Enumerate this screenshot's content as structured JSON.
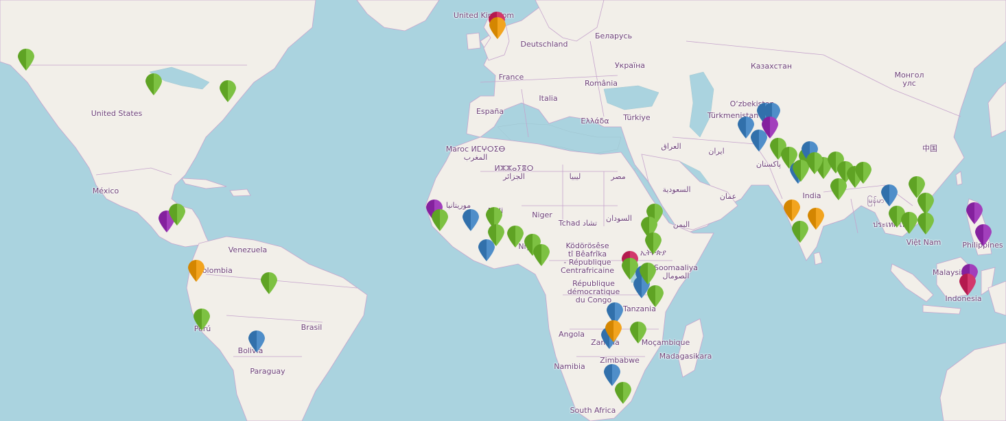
{
  "labels": [
    {
      "key": "uk",
      "text": "United Kingdom"
    },
    {
      "key": "de",
      "text": "Deutschland"
    },
    {
      "key": "by",
      "text": "Беларусь"
    },
    {
      "key": "ua",
      "text": "Україна"
    },
    {
      "key": "kz",
      "text": "Казахстан"
    },
    {
      "key": "mn",
      "text": "Монгол\nулс"
    },
    {
      "key": "fr",
      "text": "France"
    },
    {
      "key": "ro",
      "text": "România"
    },
    {
      "key": "es",
      "text": "España"
    },
    {
      "key": "it",
      "text": "Italia"
    },
    {
      "key": "gr",
      "text": "Ελλάδα"
    },
    {
      "key": "tr",
      "text": "Türkiye"
    },
    {
      "key": "uz",
      "text": "O‘zbekiston"
    },
    {
      "key": "tm",
      "text": "Türkmenistan"
    },
    {
      "key": "us",
      "text": "United States"
    },
    {
      "key": "ma",
      "text": "Maroc ⵍⵎⵖⵔⵉⴱ\nالمغرب"
    },
    {
      "key": "dz",
      "text": "ⵍⵣⵣⴰⵢⴻⵔ\nالجزائر"
    },
    {
      "key": "ly",
      "text": "ليبيا"
    },
    {
      "key": "eg",
      "text": "مصر"
    },
    {
      "key": "iq",
      "text": "العراق"
    },
    {
      "key": "ir",
      "text": "ایران"
    },
    {
      "key": "pk",
      "text": "پاکستان"
    },
    {
      "key": "cn",
      "text": "中国"
    },
    {
      "key": "mx",
      "text": "México"
    },
    {
      "key": "sa",
      "text": "السعودية"
    },
    {
      "key": "om",
      "text": "عمان"
    },
    {
      "key": "in",
      "text": "India"
    },
    {
      "key": "mr",
      "text": "موريتانيا"
    },
    {
      "key": "ml",
      "text": "Mali"
    },
    {
      "key": "ne",
      "text": "Niger"
    },
    {
      "key": "td",
      "text": "Tchad تشاد"
    },
    {
      "key": "sd",
      "text": "السودان"
    },
    {
      "key": "ye",
      "text": "اليمن"
    },
    {
      "key": "mm",
      "text": "မြန်မာ"
    },
    {
      "key": "th",
      "text": "ประเทศไทย"
    },
    {
      "key": "vn",
      "text": "Việt Nam"
    },
    {
      "key": "ph",
      "text": "Philippines"
    },
    {
      "key": "ve",
      "text": "Venezuela"
    },
    {
      "key": "ng",
      "text": "Nigeria"
    },
    {
      "key": "cf",
      "text": "Ködörösêse\ntî Bêafrîka\n- République\nCentrafricaine"
    },
    {
      "key": "et",
      "text": "ኢትዮጵያ"
    },
    {
      "key": "so",
      "text": "Soomaaliya\nالصومال"
    },
    {
      "key": "co",
      "text": "Colombia"
    },
    {
      "key": "my",
      "text": "Malaysia"
    },
    {
      "key": "cd",
      "text": "République\ndémocratique\ndu Congo"
    },
    {
      "key": "id",
      "text": "Indonesia"
    },
    {
      "key": "tz",
      "text": "Tanzania"
    },
    {
      "key": "br",
      "text": "Brasil"
    },
    {
      "key": "pe",
      "text": "Perú"
    },
    {
      "key": "ao",
      "text": "Angola"
    },
    {
      "key": "zm",
      "text": "Zambia"
    },
    {
      "key": "mz",
      "text": "Moçambique"
    },
    {
      "key": "bo",
      "text": "Bolivia"
    },
    {
      "key": "zw",
      "text": "Zimbabwe"
    },
    {
      "key": "mg",
      "text": "Madagasikara"
    },
    {
      "key": "na",
      "text": "Namibia"
    },
    {
      "key": "py",
      "text": "Paraguay"
    },
    {
      "key": "za",
      "text": "South Africa"
    }
  ],
  "marker_colors": {
    "green": "#7dc142",
    "blue": "#4f8ec9",
    "purple": "#a23fbc",
    "orange": "#f2a41f",
    "red": "#d2386c"
  },
  "markers": [
    {
      "color": "green"
    },
    {
      "color": "green"
    },
    {
      "color": "green"
    },
    {
      "color": "purple"
    },
    {
      "color": "green"
    },
    {
      "color": "orange"
    },
    {
      "color": "green"
    },
    {
      "color": "green"
    },
    {
      "color": "blue"
    },
    {
      "color": "red"
    },
    {
      "color": "orange"
    },
    {
      "color": "purple"
    },
    {
      "color": "green"
    },
    {
      "color": "blue"
    },
    {
      "color": "green"
    },
    {
      "color": "green"
    },
    {
      "color": "blue"
    },
    {
      "color": "green"
    },
    {
      "color": "green"
    },
    {
      "color": "green"
    },
    {
      "color": "green"
    },
    {
      "color": "green"
    },
    {
      "color": "green"
    },
    {
      "color": "red"
    },
    {
      "color": "green"
    },
    {
      "color": "blue"
    },
    {
      "color": "green"
    },
    {
      "color": "blue"
    },
    {
      "color": "green"
    },
    {
      "color": "blue"
    },
    {
      "color": "blue"
    },
    {
      "color": "orange"
    },
    {
      "color": "green"
    },
    {
      "color": "blue"
    },
    {
      "color": "green"
    },
    {
      "color": "blue"
    },
    {
      "color": "blue"
    },
    {
      "color": "blue"
    },
    {
      "color": "purple"
    },
    {
      "color": "blue"
    },
    {
      "color": "green"
    },
    {
      "color": "green"
    },
    {
      "color": "blue"
    },
    {
      "color": "green"
    },
    {
      "color": "green"
    },
    {
      "color": "green"
    },
    {
      "color": "blue"
    },
    {
      "color": "green"
    },
    {
      "color": "green"
    },
    {
      "color": "green"
    },
    {
      "color": "green"
    },
    {
      "color": "green"
    },
    {
      "color": "green"
    },
    {
      "color": "orange"
    },
    {
      "color": "orange"
    },
    {
      "color": "green"
    },
    {
      "color": "blue"
    },
    {
      "color": "green"
    },
    {
      "color": "green"
    },
    {
      "color": "green"
    },
    {
      "color": "green"
    },
    {
      "color": "green"
    },
    {
      "color": "purple"
    },
    {
      "color": "purple"
    },
    {
      "color": "purple"
    },
    {
      "color": "red"
    }
  ]
}
